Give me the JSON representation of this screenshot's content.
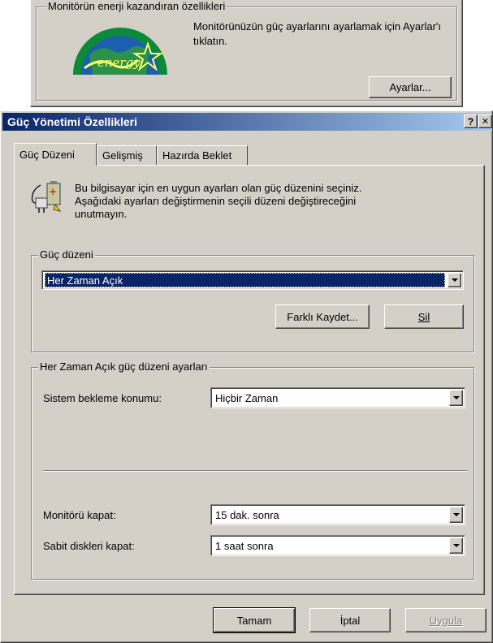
{
  "monitor_panel": {
    "group_title": "Monitörün enerji kazandıran özellikleri",
    "description": "Monitörünüzün güç ayarlarını ayarlamak için Ayarlar'ı tıklatın.",
    "settings_button": "Ayarlar...",
    "logo_text": "energy",
    "logo_icon": "energy-star-logo"
  },
  "window": {
    "title": "Güç Yönetimi Özellikleri",
    "help_button": "?",
    "close_button": "✕",
    "title_gradient": [
      "#0a246a",
      "#a6caf0"
    ]
  },
  "tabs": [
    {
      "label": "Güç Düzeni",
      "active": true
    },
    {
      "label": "Gelişmiş",
      "active": false
    },
    {
      "label": "Hazırda Beklet",
      "active": false
    }
  ],
  "intro": {
    "icon": "power-plug-battery-icon",
    "text_line1": "Bu bilgisayar için en uygun ayarları olan güç düzenini seçiniz.",
    "text_line2": "Aşağıdaki ayarları değiştirmenin seçili düzeni değiştireceğini",
    "text_line3": "unutmayın."
  },
  "scheme_group": {
    "title": "Güç düzeni",
    "selected_value": "Her Zaman Açık",
    "save_as_button": "Farklı Kaydet...",
    "delete_button": "Sil"
  },
  "settings_group": {
    "title": "Her Zaman Açık güç düzeni ayarları",
    "standby_label": "Sistem bekleme konumu:",
    "standby_value": "Hiçbir Zaman",
    "monitor_label": "Monitörü kapat:",
    "monitor_value": "15 dak. sonra",
    "disks_label": "Sabit diskleri kapat:",
    "disks_value": "1 saat sonra"
  },
  "footer": {
    "ok_button": "Tamam",
    "cancel_button": "İptal",
    "apply_button": "Uygula"
  },
  "colors": {
    "face": "#d4d0c8",
    "selection": "#0a246a"
  }
}
